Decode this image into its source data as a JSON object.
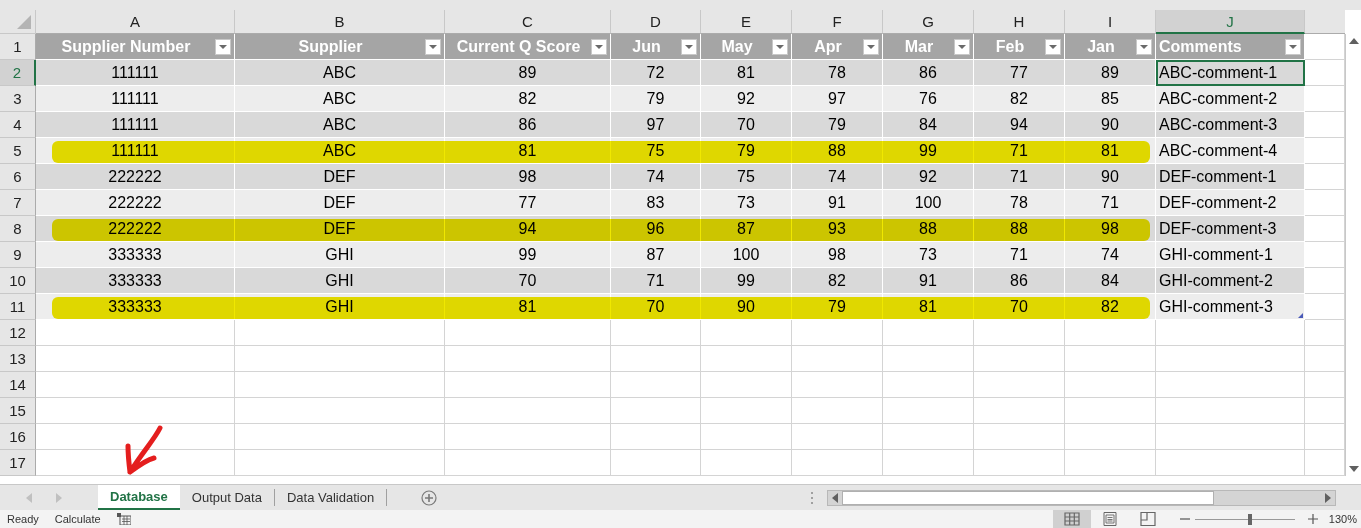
{
  "columns": [
    {
      "letter": "A",
      "selected": false
    },
    {
      "letter": "B",
      "selected": false
    },
    {
      "letter": "C",
      "selected": false
    },
    {
      "letter": "D",
      "selected": false
    },
    {
      "letter": "E",
      "selected": false
    },
    {
      "letter": "F",
      "selected": false
    },
    {
      "letter": "G",
      "selected": false
    },
    {
      "letter": "H",
      "selected": false
    },
    {
      "letter": "I",
      "selected": false
    },
    {
      "letter": "J",
      "selected": true
    }
  ],
  "table": {
    "header_row_number": "1",
    "headers": [
      "Supplier Number",
      "Supplier",
      "Current Q Score",
      "Jun",
      "May",
      "Apr",
      "Mar",
      "Feb",
      "Jan",
      "Comments"
    ],
    "rows": [
      {
        "number": "2",
        "selected": true,
        "highlighted": false,
        "cells": [
          "111111",
          "ABC",
          "89",
          "72",
          "81",
          "78",
          "86",
          "77",
          "89",
          "ABC-comment-1"
        ]
      },
      {
        "number": "3",
        "selected": false,
        "highlighted": false,
        "cells": [
          "111111",
          "ABC",
          "82",
          "79",
          "92",
          "97",
          "76",
          "82",
          "85",
          "ABC-comment-2"
        ]
      },
      {
        "number": "4",
        "selected": false,
        "highlighted": false,
        "cells": [
          "111111",
          "ABC",
          "86",
          "97",
          "70",
          "79",
          "84",
          "94",
          "90",
          "ABC-comment-3"
        ]
      },
      {
        "number": "5",
        "selected": false,
        "highlighted": true,
        "cells": [
          "111111",
          "ABC",
          "81",
          "75",
          "79",
          "88",
          "99",
          "71",
          "81",
          "ABC-comment-4"
        ]
      },
      {
        "number": "6",
        "selected": false,
        "highlighted": false,
        "cells": [
          "222222",
          "DEF",
          "98",
          "74",
          "75",
          "74",
          "92",
          "71",
          "90",
          "DEF-comment-1"
        ]
      },
      {
        "number": "7",
        "selected": false,
        "highlighted": false,
        "cells": [
          "222222",
          "DEF",
          "77",
          "83",
          "73",
          "91",
          "100",
          "78",
          "71",
          "DEF-comment-2"
        ]
      },
      {
        "number": "8",
        "selected": false,
        "highlighted": true,
        "cells": [
          "222222",
          "DEF",
          "94",
          "96",
          "87",
          "93",
          "88",
          "88",
          "98",
          "DEF-comment-3"
        ]
      },
      {
        "number": "9",
        "selected": false,
        "highlighted": false,
        "cells": [
          "333333",
          "GHI",
          "99",
          "87",
          "100",
          "98",
          "73",
          "71",
          "74",
          "GHI-comment-1"
        ]
      },
      {
        "number": "10",
        "selected": false,
        "highlighted": false,
        "cells": [
          "333333",
          "GHI",
          "70",
          "71",
          "99",
          "82",
          "91",
          "86",
          "84",
          "GHI-comment-2"
        ]
      },
      {
        "number": "11",
        "selected": false,
        "highlighted": true,
        "cells": [
          "333333",
          "GHI",
          "81",
          "70",
          "90",
          "79",
          "81",
          "70",
          "82",
          "GHI-comment-3"
        ]
      }
    ]
  },
  "empty_rows": [
    "12",
    "13",
    "14",
    "15",
    "16",
    "17"
  ],
  "sheet_tabs": [
    {
      "label": "Database",
      "selected": true
    },
    {
      "label": "Output Data",
      "selected": false
    },
    {
      "label": "Data Validation",
      "selected": false
    }
  ],
  "status_bar": {
    "items": [
      "Ready",
      "Calculate"
    ],
    "views": [
      {
        "kind": "normal",
        "selected": true
      },
      {
        "kind": "page_layout",
        "selected": false
      },
      {
        "kind": "page_break",
        "selected": false
      }
    ],
    "zoom": {
      "level": 0.55,
      "reading": "130%"
    }
  }
}
